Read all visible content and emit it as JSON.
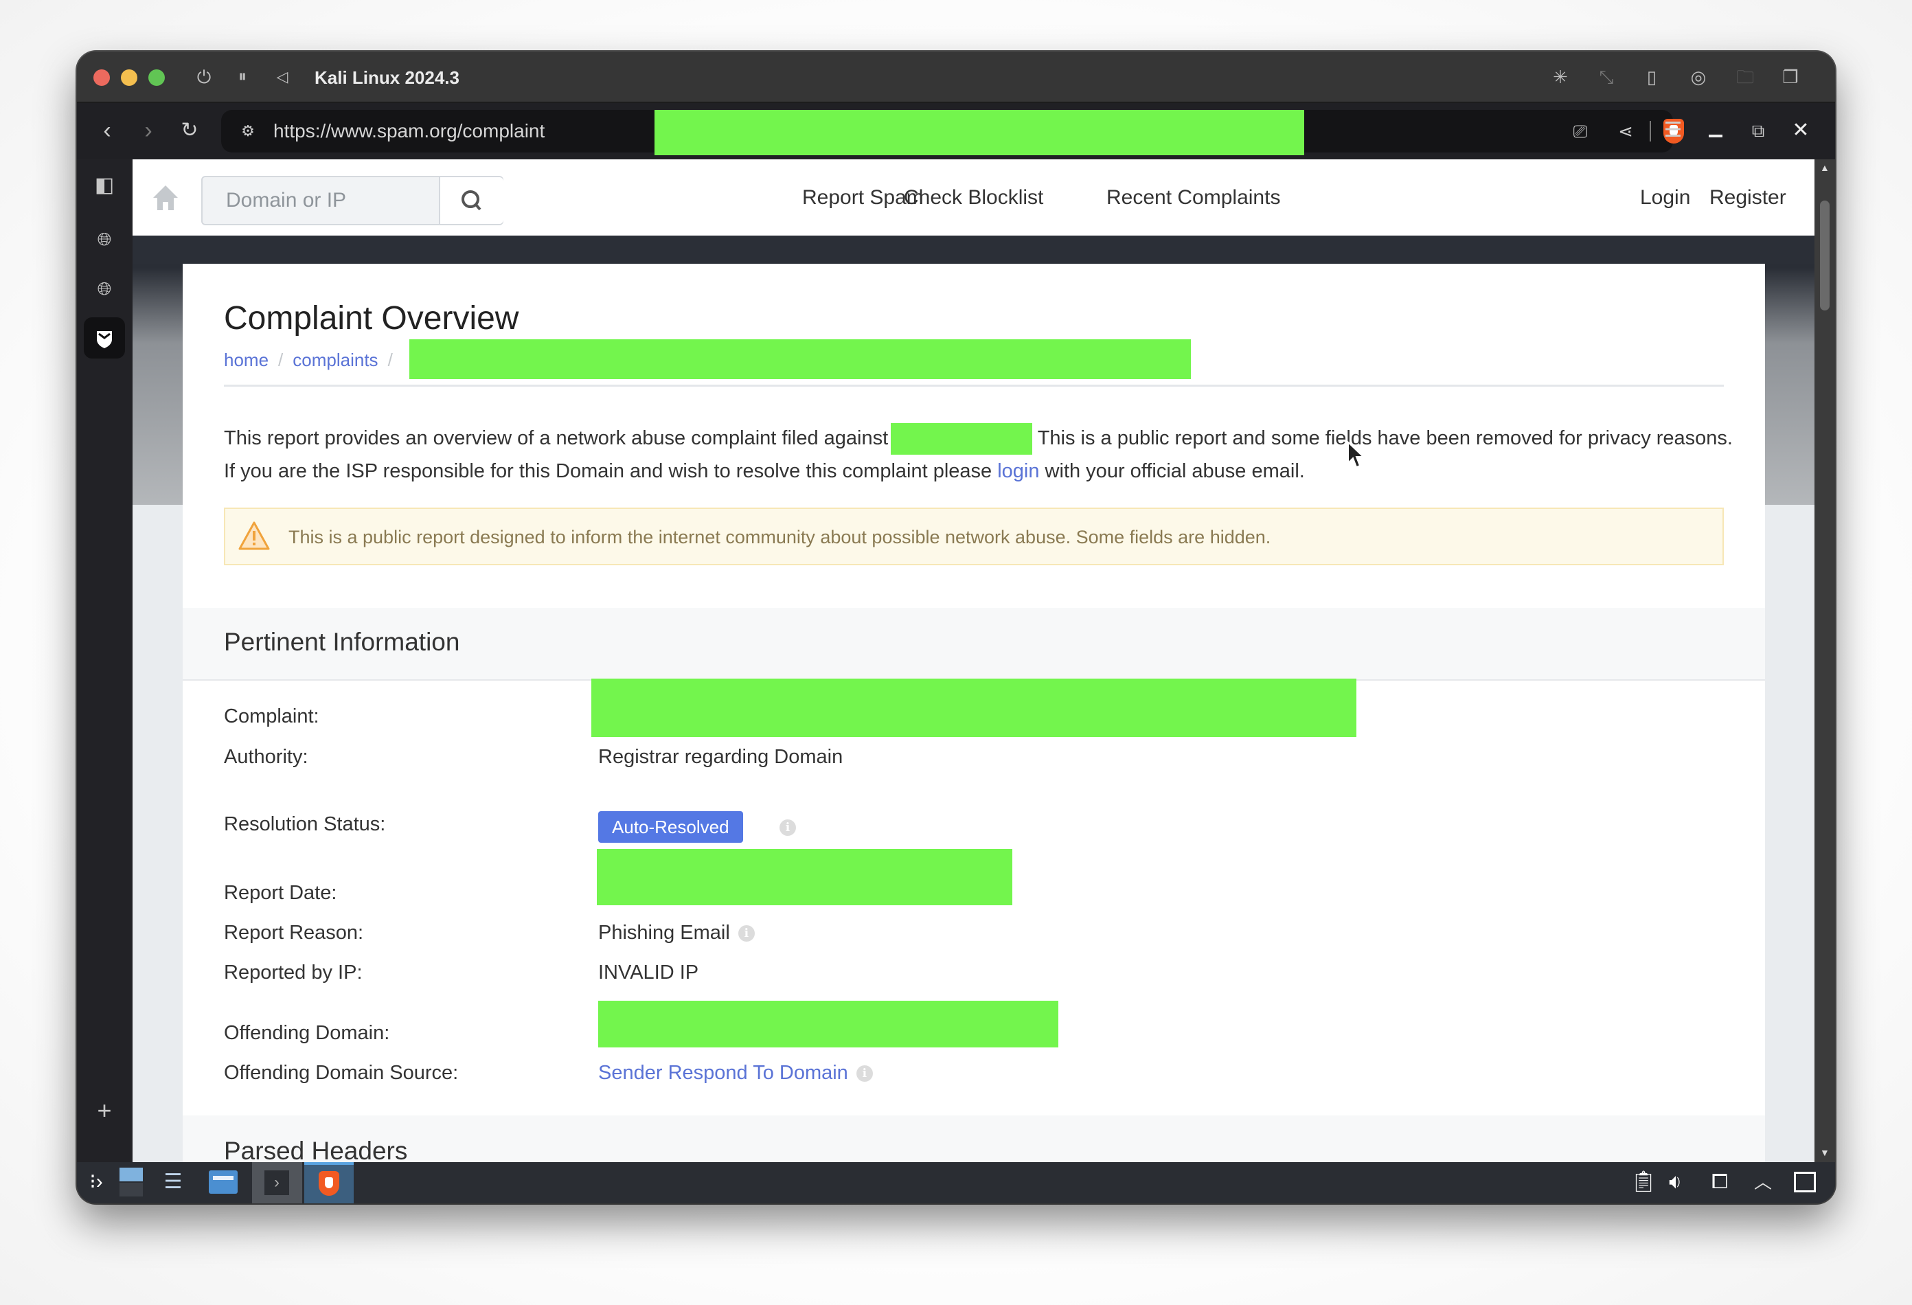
{
  "window": {
    "title": "Kali Linux 2024.3",
    "titlebar_icons": [
      "power-icon",
      "pause-icon",
      "back-triangle-icon"
    ],
    "right_icons": [
      "cursor-spark-icon",
      "resize-icon",
      "usb-icon",
      "disc-icon",
      "shared-folder-icon",
      "windows-icon"
    ]
  },
  "browser": {
    "url": "https://www.spam.org/complaint",
    "url_redacted": true,
    "toolbar_icons": [
      "install-app-icon",
      "share-icon",
      "brave-shields-icon"
    ],
    "menu_icons": [
      "hamburger-menu-icon",
      "minimize-icon",
      "restore-icon",
      "close-icon"
    ],
    "sidebar_icons": [
      "sidebar-toggle-icon",
      "globe-icon",
      "globe-icon",
      "mail-shield-icon",
      "add-icon"
    ]
  },
  "site": {
    "search": {
      "placeholder": "Domain or IP",
      "value": ""
    },
    "nav": [
      {
        "label": "Report Spam"
      },
      {
        "label": "Check Blocklist"
      },
      {
        "label": "Recent Complaints"
      }
    ],
    "auth": {
      "login": "Login",
      "register": "Register"
    }
  },
  "page": {
    "title": "Complaint Overview",
    "breadcrumb": [
      "home",
      "complaints"
    ],
    "intro": {
      "part1": "This report provides an overview of a network abuse complaint filed against",
      "part2": " This is a public report and some fields have been removed for privacy reasons. If you are the ISP responsible for this Domain and wish to resolve this complaint please ",
      "link": "login",
      "part3": " with your official abuse email."
    },
    "alert": "This is a public report designed to inform the internet community about possible network abuse. Some fields are hidden."
  },
  "pertinent": {
    "title": "Pertinent Information",
    "rows": [
      {
        "label": "Complaint:",
        "value": "",
        "redacted": true
      },
      {
        "label": "Authority:",
        "value": "Registrar regarding Domain"
      },
      {
        "label": "Resolution Status:",
        "value": "Auto-Resolved",
        "badge_color": "#5478e4"
      },
      {
        "label": "Report Date:",
        "value": "",
        "redacted": true
      },
      {
        "label": "Report Reason:",
        "value": "Phishing Email"
      },
      {
        "label": "Reported by IP:",
        "value": "INVALID IP"
      },
      {
        "label": "Offending Domain:",
        "value": "",
        "redacted": true
      },
      {
        "label": "Offending Domain Source:",
        "value": "Sender Respond To Domain"
      }
    ]
  },
  "parsed_headers": {
    "title": "Parsed Headers"
  },
  "taskbar": {
    "apps": [
      "kali-menu-icon",
      "workspace-switcher-icon",
      "settings-icon",
      "file-manager-icon",
      "terminal-icon",
      "brave-browser-icon"
    ],
    "tray": [
      "clipboard-icon",
      "volume-icon",
      "network-icon",
      "tray-expand-icon",
      "show-desktop-icon"
    ]
  },
  "colors": {
    "accent_link": "#5a73d6",
    "redaction": "#73f54d",
    "badge": "#5478e4",
    "alert_bg": "#fdf9e9"
  }
}
